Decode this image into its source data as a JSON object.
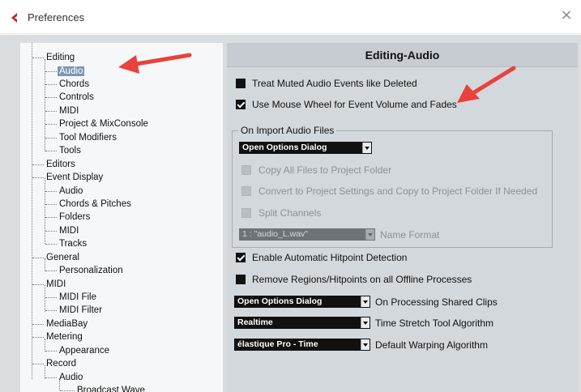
{
  "window": {
    "title": "Preferences",
    "close_glyph": "×",
    "app_icon": "cubase-logo-icon",
    "accent_color": "#c0282d",
    "selection_color": "#7d95b3"
  },
  "tree": {
    "items": [
      "Editing",
      "Audio",
      "Chords",
      "Controls",
      "MIDI",
      "Project & MixConsole",
      "Tool Modifiers",
      "Tools",
      "Editors",
      "Event Display",
      "Audio",
      "Chords & Pitches",
      "Folders",
      "MIDI",
      "Tracks",
      "General",
      "Personalization",
      "MIDI",
      "MIDI File",
      "MIDI Filter",
      "MediaBay",
      "Metering",
      "Appearance",
      "Record",
      "Audio",
      "Broadcast Wave"
    ],
    "selected_index": 1
  },
  "panel": {
    "title": "Editing-Audio",
    "treat_muted": {
      "label": "Treat Muted Audio Events like Deleted",
      "checked": false
    },
    "mouse_wheel": {
      "label": "Use Mouse Wheel for Event Volume and Fades",
      "checked": true
    },
    "import_group": {
      "title": "On Import Audio Files",
      "dropdown": "Open Options Dialog",
      "copy_files": {
        "label": "Copy All Files to Project Folder",
        "checked": false,
        "disabled": true
      },
      "convert": {
        "label": "Convert to Project Settings and Copy to Project Folder If Needed",
        "checked": false,
        "disabled": true
      },
      "split": {
        "label": "Split Channels",
        "checked": false,
        "disabled": true
      },
      "name_format_value": "1 : \"audio_L.wav\"",
      "name_format_label": "Name Format"
    },
    "hitpoint": {
      "label": "Enable Automatic Hitpoint Detection",
      "checked": true
    },
    "remove_regions": {
      "label": "Remove Regions/Hitpoints on all Offline Processes",
      "checked": false
    },
    "shared_clips": {
      "value": "Open Options Dialog",
      "label": "On Processing Shared Clips"
    },
    "time_stretch": {
      "value": "Realtime",
      "label": "Time Stretch Tool Algorithm"
    },
    "warping": {
      "value": "élastique Pro - Time",
      "label": "Default Warping Algorithm"
    }
  },
  "annotations": {
    "arrow_color": "#e8423b"
  }
}
